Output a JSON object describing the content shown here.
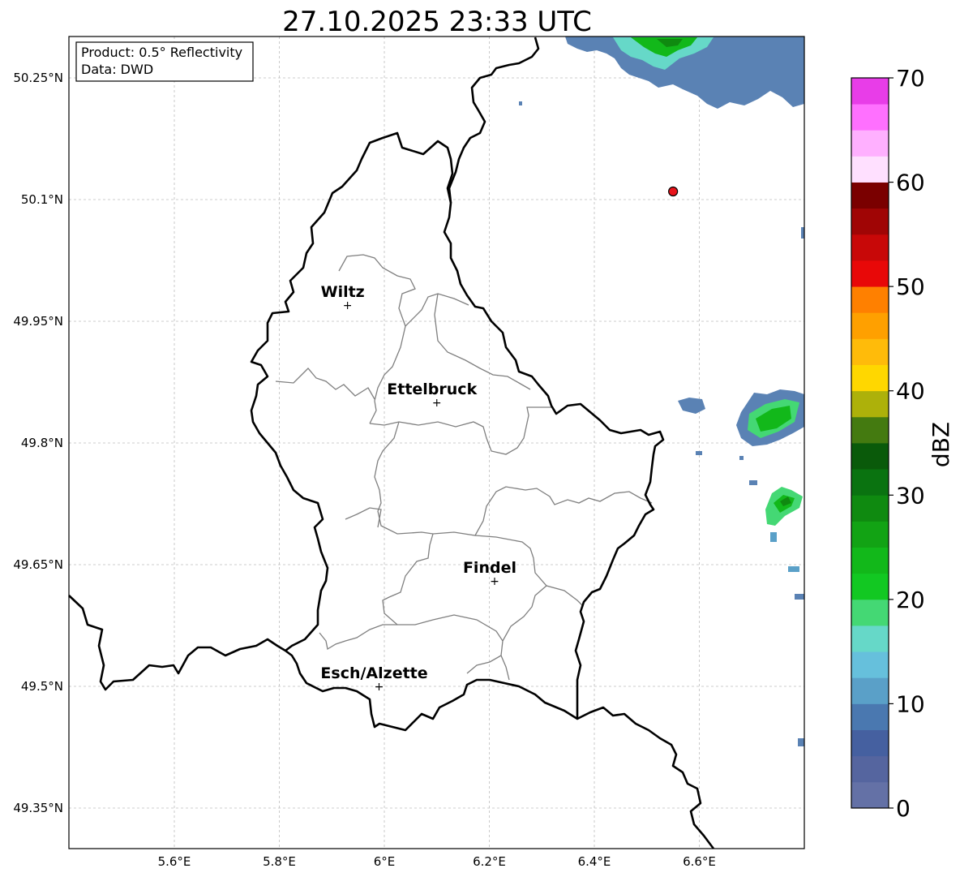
{
  "title": "27.10.2025 23:33 UTC",
  "info_box": {
    "product": "Product: 0.5° Reflectivity",
    "data": "Data: DWD"
  },
  "axes": {
    "lon_ticks": [
      "5.6°E",
      "5.8°E",
      "6°E",
      "6.2°E",
      "6.4°E",
      "6.6°E"
    ],
    "lat_ticks": [
      "50.25°N",
      "50.1°N",
      "49.95°N",
      "49.8°N",
      "49.65°N",
      "49.5°N",
      "49.35°N"
    ]
  },
  "cities": [
    {
      "name": "Wiltz",
      "lon": 5.93,
      "lat": 49.97
    },
    {
      "name": "Ettelbruck",
      "lon": 6.1,
      "lat": 49.85
    },
    {
      "name": "Findel",
      "lon": 6.21,
      "lat": 49.63
    },
    {
      "name": "Esch/Alzette",
      "lon": 5.99,
      "lat": 49.5
    }
  ],
  "radar_site": {
    "lon": 6.55,
    "lat": 50.11,
    "color": "#e8141b"
  },
  "colorbar": {
    "label": "dBZ",
    "ticks": [
      "0",
      "10",
      "20",
      "30",
      "40",
      "50",
      "60",
      "70"
    ],
    "vmin": 0,
    "vmax": 70,
    "colors": [
      "#6471a6",
      "#55659f",
      "#4560a0",
      "#4a78b0",
      "#5aa0c8",
      "#66c0dc",
      "#66d8c8",
      "#44d874",
      "#12c822",
      "#12b81a",
      "#12a314",
      "#0f8a10",
      "#0a7310",
      "#0a5a0a",
      "#447a10",
      "#adb10a",
      "#ffd700",
      "#ffbb0a",
      "#ffa000",
      "#ff8000",
      "#e80808",
      "#c80808",
      "#a00505",
      "#7a0000",
      "#ffe0ff",
      "#ffb0ff",
      "#ff70ff",
      "#e83de8"
    ]
  }
}
